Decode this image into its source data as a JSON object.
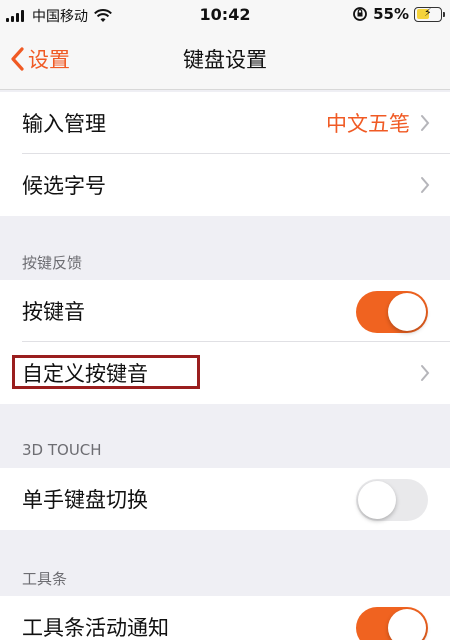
{
  "status_bar": {
    "carrier": "中国移动",
    "time": "10:42",
    "battery_percent": "55%",
    "battery_level": 0.55,
    "icons": [
      "signal-icon",
      "wifi-icon",
      "orientation-lock-icon",
      "battery-icon"
    ]
  },
  "nav": {
    "back_label": "设置",
    "title": "键盘设置"
  },
  "group1": {
    "items": [
      {
        "label": "输入管理",
        "value": "中文五笔"
      },
      {
        "label": "候选字号"
      }
    ]
  },
  "section_keyfeedback": {
    "header": "按键反馈",
    "items": [
      {
        "label": "按键音",
        "toggle": "on"
      },
      {
        "label": "自定义按键音"
      }
    ]
  },
  "section_3dtouch": {
    "header": "3D TOUCH",
    "items": [
      {
        "label": "单手键盘切换",
        "toggle": "off"
      }
    ]
  },
  "section_toolbar": {
    "header": "工具条",
    "items": [
      {
        "label": "工具条活动通知",
        "toggle": "on"
      }
    ]
  },
  "colors": {
    "accent": "#f05a24",
    "highlight_box": "#9a1e1e",
    "background": "#efeff4"
  }
}
